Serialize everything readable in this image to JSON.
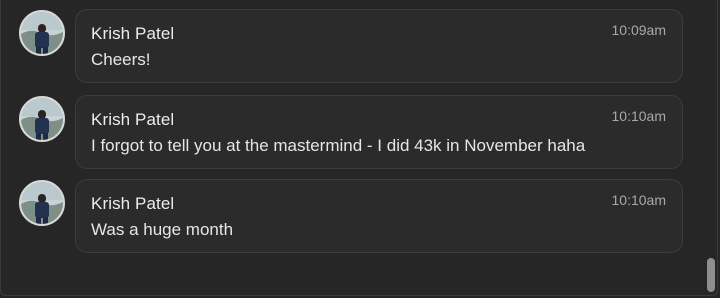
{
  "messages": [
    {
      "author": "Krish Patel",
      "time": "10:09am",
      "text": "Cheers!",
      "avatar_icon": "user-photo-avatar"
    },
    {
      "author": "Krish Patel",
      "time": "10:10am",
      "text": "I forgot to tell you at the mastermind - I did 43k in November haha",
      "avatar_icon": "user-photo-avatar"
    },
    {
      "author": "Krish Patel",
      "time": "10:10am",
      "text": "Was a huge month",
      "avatar_icon": "user-photo-avatar"
    }
  ],
  "colors": {
    "background": "#262626",
    "bubble": "#2b2b2b",
    "bubble_border": "#3c3c3c",
    "name_text": "#ececec",
    "time_text": "#a9a9a9",
    "scroll_thumb": "#8e8e8e"
  }
}
